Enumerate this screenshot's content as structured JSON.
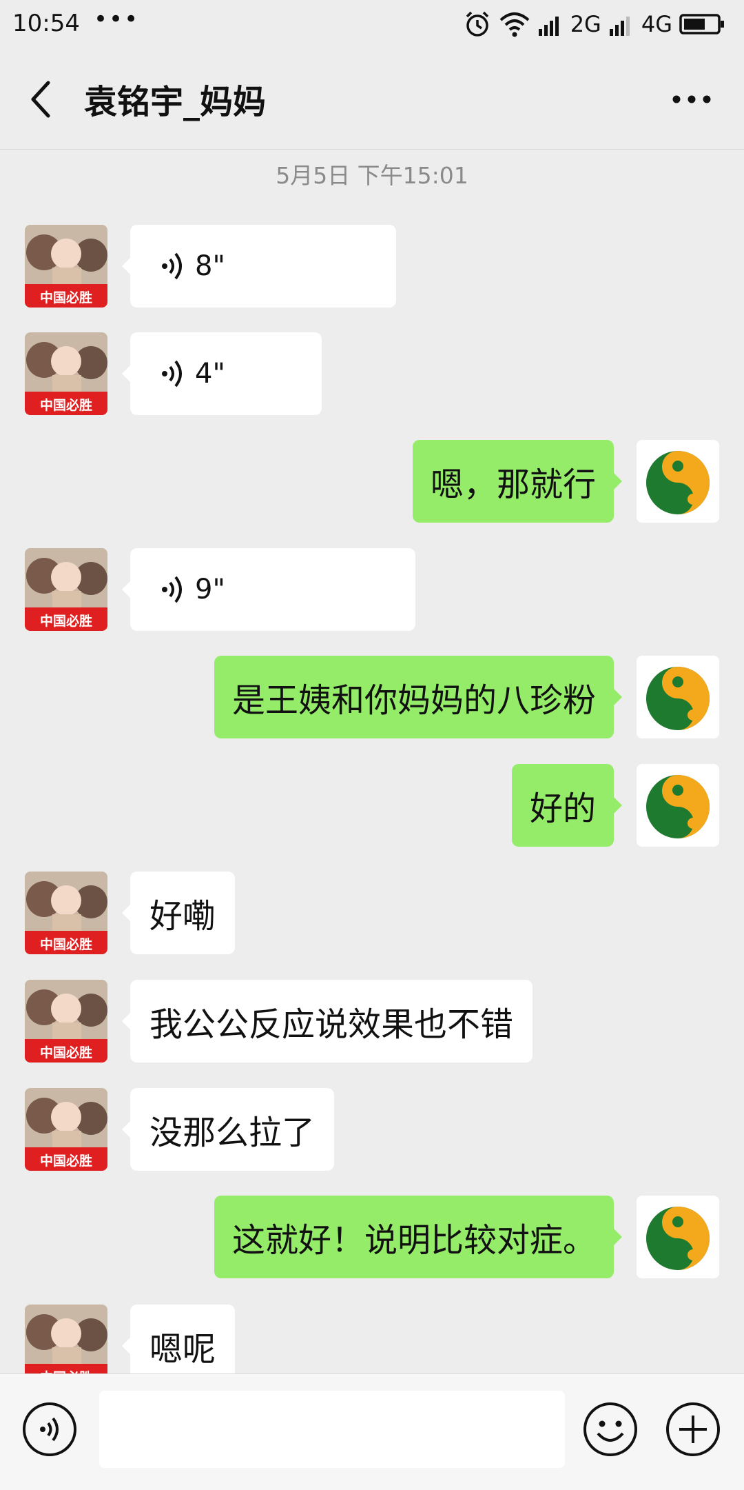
{
  "status_bar": {
    "time": "10:54",
    "dots": "•••",
    "network_2g": "2G",
    "network_4g": "4G"
  },
  "header": {
    "title": "袁铭宇_妈妈"
  },
  "chat": {
    "timestamp": "5月5日 下午15:01",
    "messages": [
      {
        "side": "left",
        "type": "voice",
        "duration": "8\""
      },
      {
        "side": "left",
        "type": "voice",
        "duration": "4\""
      },
      {
        "side": "right",
        "type": "text",
        "text": "嗯，那就行"
      },
      {
        "side": "left",
        "type": "voice",
        "duration": "9\""
      },
      {
        "side": "right",
        "type": "text",
        "text": "是王姨和你妈妈的八珍粉"
      },
      {
        "side": "right",
        "type": "text",
        "text": "好的"
      },
      {
        "side": "left",
        "type": "text",
        "text": "好嘞"
      },
      {
        "side": "left",
        "type": "text",
        "text": "我公公反应说效果也不错"
      },
      {
        "side": "left",
        "type": "text",
        "text": "没那么拉了"
      },
      {
        "side": "right",
        "type": "text",
        "text": "这就好！说明比较对症。"
      },
      {
        "side": "left",
        "type": "text",
        "text": "嗯呢"
      }
    ]
  },
  "avatars": {
    "contact_banner_text": "中国必胜"
  },
  "input_bar": {
    "placeholder": ""
  },
  "colors": {
    "background": "#ededed",
    "sent_bubble": "#95ec69",
    "received_bubble": "#ffffff",
    "banner_red": "#e02020",
    "logo_green": "#1e7a2e",
    "logo_orange": "#f4a81c"
  }
}
